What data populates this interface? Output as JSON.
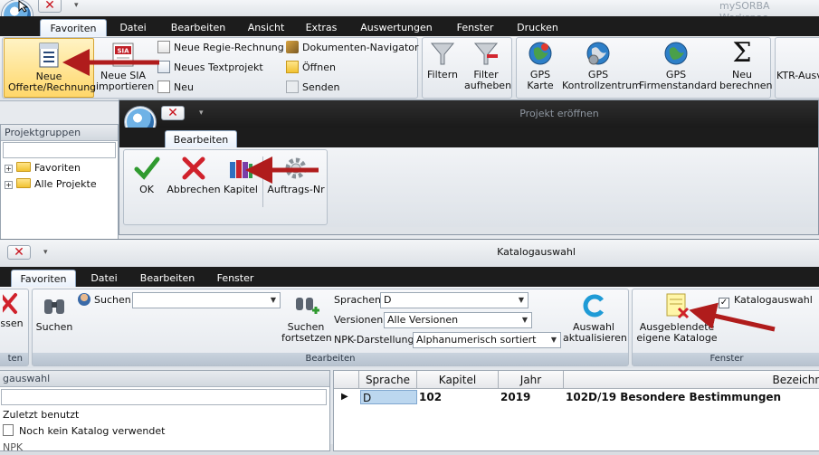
{
  "main_window": {
    "title": "mySORBA Workspac",
    "tabs": [
      "Favoriten",
      "Datei",
      "Bearbeiten",
      "Ansicht",
      "Extras",
      "Auswertungen",
      "Fenster",
      "Drucken"
    ],
    "buttons": {
      "neue_offerte": "Neue Offerte/Rechnung",
      "neue_sia": "Neue SIA importieren",
      "neue_regie": "Neue Regie-Rechnung",
      "neues_text": "Neues Textprojekt",
      "neu": "Neu",
      "dok_nav": "Dokumenten-Navigator",
      "oeffnen": "Öffnen",
      "senden": "Senden",
      "filtern": "Filtern",
      "filter_aufheben": "Filter aufheben",
      "gps_karte": "GPS Karte",
      "gps_kontroll": "GPS Kontrollzentrum",
      "gps_firmen": "GPS Firmenstandard",
      "neu_berechnen": "Neu berechnen",
      "ktr": "KTR-Ausv"
    },
    "left_panel": {
      "header": "Projektgruppen",
      "items": [
        "Favoriten",
        "Alle Projekte"
      ]
    }
  },
  "project_window": {
    "title": "Projekt eröffnen",
    "tab": "Bearbeiten",
    "buttons": {
      "ok": "OK",
      "abbrechen": "Abbrechen",
      "kapitel": "Kapitel",
      "auftrags_nr": "Auftrags-Nr"
    }
  },
  "catalog_window": {
    "title": "Katalogauswahl",
    "tabs": [
      "Favoriten",
      "Datei",
      "Bearbeiten",
      "Fenster"
    ],
    "group_labels": {
      "left": "ssen",
      "left_bottom": "ten",
      "bearbeiten": "Bearbeiten",
      "fenster": "Fenster"
    },
    "buttons": {
      "suchen_big": "Suchen",
      "suchen_small": "Suchen",
      "suchen_fortsetzen": "Suchen fortsetzen",
      "auswahl_aktualisieren": "Auswahl aktualisieren",
      "ausgeblendete": "Ausgeblendete eigene Kataloge",
      "katalogauswahl_check": "Katalogauswahl"
    },
    "fields": {
      "sprachen_label": "Sprachen",
      "sprachen_value": "D",
      "versionen_label": "Versionen",
      "versionen_value": "Alle Versionen",
      "npk_label": "NPK-Darstellung",
      "npk_value": "Alphanumerisch sortiert",
      "suchen_value": ""
    },
    "left_panel": {
      "header": "gauswahl",
      "items": [
        "Zuletzt benutzt",
        "Noch kein Katalog verwendet",
        "NPK"
      ]
    },
    "grid": {
      "headers": [
        "Sprache",
        "Kapitel",
        "Jahr",
        "Bezeichn"
      ],
      "row": {
        "sprache": "D",
        "kapitel": "102",
        "jahr": "2019",
        "bezeichnung": "102D/19 Besondere Bestimmungen"
      }
    }
  },
  "colors": {
    "arrow": "#b01c1c",
    "ribbon_tab_bar": "#1c1c1c",
    "highlight": "#ffd76a"
  }
}
